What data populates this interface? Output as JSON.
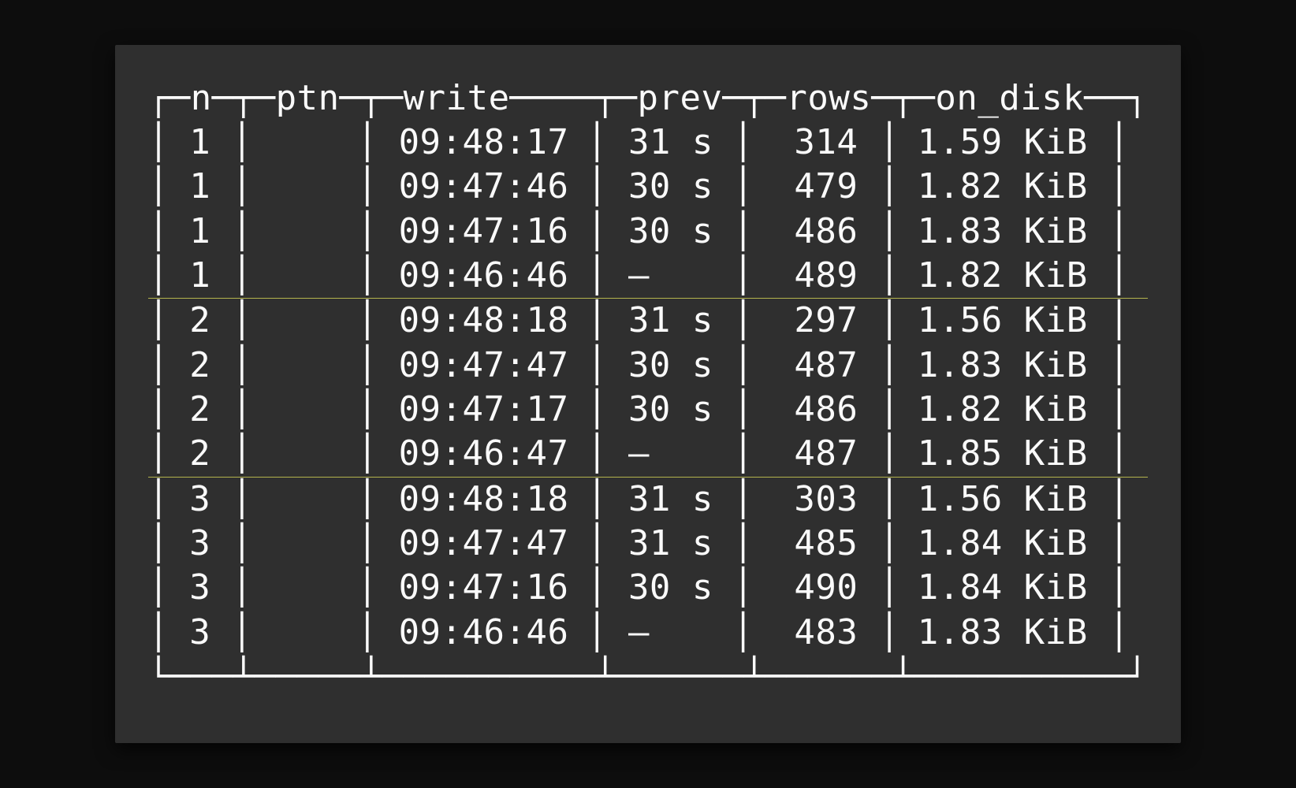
{
  "table": {
    "columns": [
      "n",
      "ptn",
      "write",
      "prev",
      "rows",
      "on_disk"
    ],
    "groups": [
      {
        "rows": [
          {
            "n": "1",
            "ptn": "",
            "write": "09:48:17",
            "prev": "31 s",
            "rows": "314",
            "on_disk": "1.59 KiB"
          },
          {
            "n": "1",
            "ptn": "",
            "write": "09:47:46",
            "prev": "30 s",
            "rows": "479",
            "on_disk": "1.82 KiB"
          },
          {
            "n": "1",
            "ptn": "",
            "write": "09:47:16",
            "prev": "30 s",
            "rows": "486",
            "on_disk": "1.83 KiB"
          },
          {
            "n": "1",
            "ptn": "",
            "write": "09:46:46",
            "prev": "—",
            "rows": "489",
            "on_disk": "1.82 KiB"
          }
        ]
      },
      {
        "rows": [
          {
            "n": "2",
            "ptn": "",
            "write": "09:48:18",
            "prev": "31 s",
            "rows": "297",
            "on_disk": "1.56 KiB"
          },
          {
            "n": "2",
            "ptn": "",
            "write": "09:47:47",
            "prev": "30 s",
            "rows": "487",
            "on_disk": "1.83 KiB"
          },
          {
            "n": "2",
            "ptn": "",
            "write": "09:47:17",
            "prev": "30 s",
            "rows": "486",
            "on_disk": "1.82 KiB"
          },
          {
            "n": "2",
            "ptn": "",
            "write": "09:46:47",
            "prev": "—",
            "rows": "487",
            "on_disk": "1.85 KiB"
          }
        ]
      },
      {
        "rows": [
          {
            "n": "3",
            "ptn": "",
            "write": "09:48:18",
            "prev": "31 s",
            "rows": "303",
            "on_disk": "1.56 KiB"
          },
          {
            "n": "3",
            "ptn": "",
            "write": "09:47:47",
            "prev": "31 s",
            "rows": "485",
            "on_disk": "1.84 KiB"
          },
          {
            "n": "3",
            "ptn": "",
            "write": "09:47:16",
            "prev": "30 s",
            "rows": "490",
            "on_disk": "1.84 KiB"
          },
          {
            "n": "3",
            "ptn": "",
            "write": "09:46:46",
            "prev": "—",
            "rows": "483",
            "on_disk": "1.83 KiB"
          }
        ]
      }
    ]
  }
}
